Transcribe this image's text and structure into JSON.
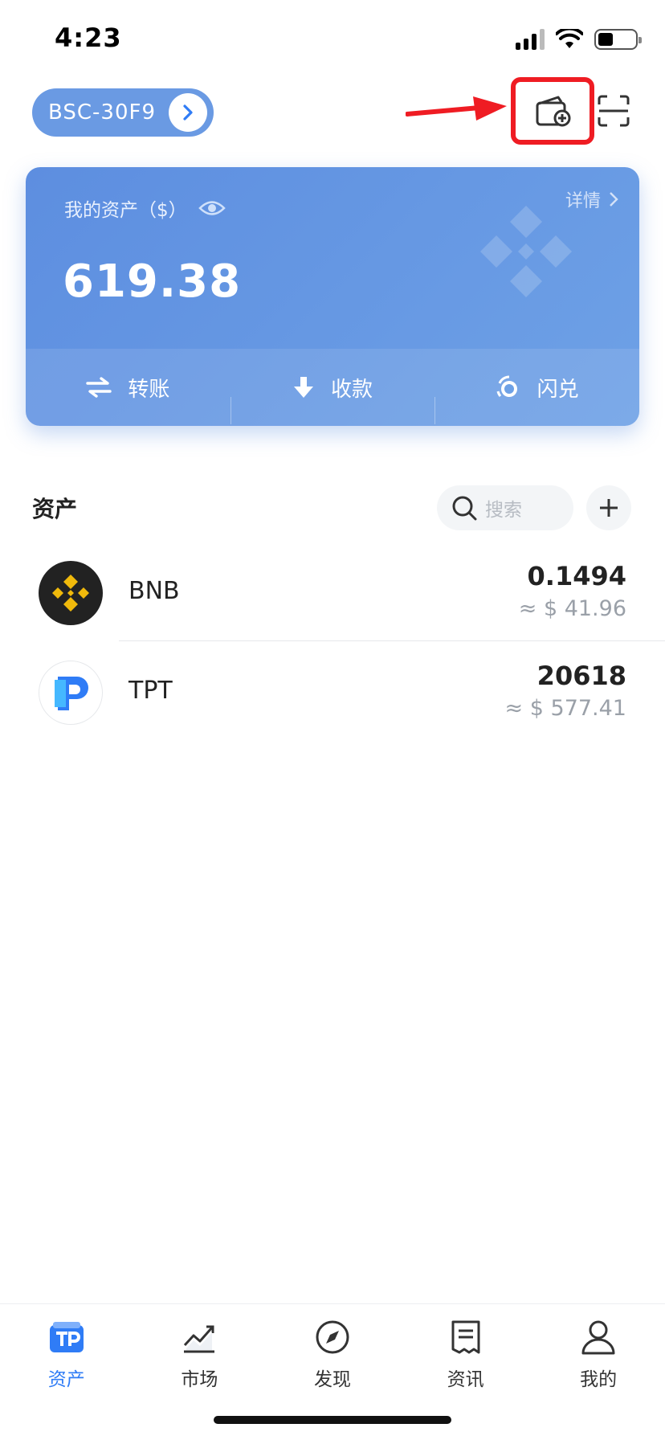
{
  "status_bar": {
    "time": "4:23"
  },
  "header": {
    "wallet_name": "BSC-30F9",
    "icons": [
      "chevron-right-icon",
      "wallet-add-icon",
      "scan-icon",
      "red-arrow-annotation"
    ]
  },
  "asset_card": {
    "label": "我的资产（$）",
    "detail": "详情",
    "total": "619.38",
    "actions": [
      {
        "label": "转账",
        "icon": "transfer-icon"
      },
      {
        "label": "收款",
        "icon": "receive-icon"
      },
      {
        "label": "闪兑",
        "icon": "swap-icon"
      }
    ]
  },
  "assets": {
    "title": "资产",
    "search_placeholder": "搜索",
    "tokens": [
      {
        "symbol": "BNB",
        "amount": "0.1494",
        "fiat": "≈ $ 41.96",
        "icon": "bnb-logo-icon"
      },
      {
        "symbol": "TPT",
        "amount": "20618",
        "fiat": "≈ $ 577.41",
        "icon": "tpt-logo-icon"
      }
    ]
  },
  "tab_bar": {
    "tabs": [
      {
        "label": "资产",
        "active": true,
        "icon": "tp-wallet-icon"
      },
      {
        "label": "市场",
        "active": false,
        "icon": "market-chart-icon"
      },
      {
        "label": "发现",
        "active": false,
        "icon": "compass-icon"
      },
      {
        "label": "资讯",
        "active": false,
        "icon": "news-icon"
      },
      {
        "label": "我的",
        "active": false,
        "icon": "profile-icon"
      }
    ]
  },
  "colors": {
    "accent": "#2f7cf6",
    "card": "#6a9ae3",
    "annotation": "#ef1c23",
    "bnb": "#f0b90b"
  }
}
